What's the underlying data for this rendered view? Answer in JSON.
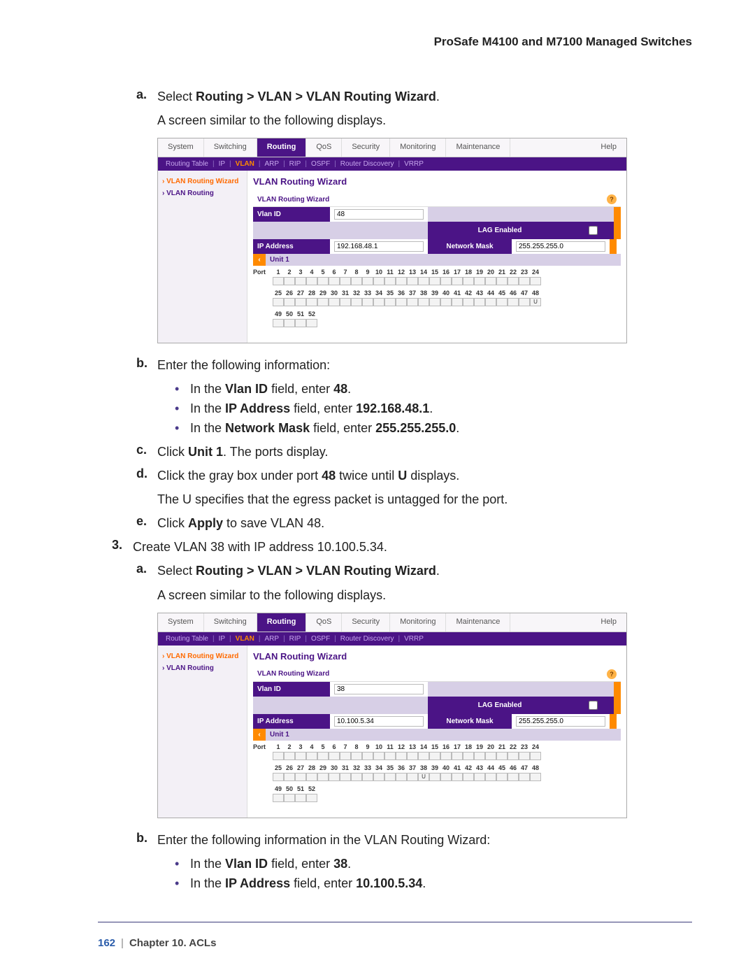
{
  "header": "ProSafe M4100 and M7100 Managed Switches",
  "stepA": {
    "marker": "a.",
    "text_pre": "Select ",
    "bold": "Routing > VLAN > VLAN Routing Wizard",
    "text_post": ".",
    "sub": "A screen similar to the following displays."
  },
  "shot1": {
    "tabs": [
      "System",
      "Switching",
      "Routing",
      "QoS",
      "Security",
      "Monitoring",
      "Maintenance",
      "Help"
    ],
    "tab_active": 2,
    "subtabs": [
      "Routing Table",
      "IP",
      "VLAN",
      "ARP",
      "RIP",
      "OSPF",
      "Router Discovery",
      "VRRP"
    ],
    "subtab_active": 2,
    "sidebar": [
      {
        "text": "VLAN Routing Wizard",
        "active": true
      },
      {
        "text": "VLAN Routing",
        "active": false
      }
    ],
    "title": "VLAN Routing Wizard",
    "section": "VLAN Routing Wizard",
    "fields": {
      "vlan_id_label": "Vlan ID",
      "vlan_id": "48",
      "lag_label": "LAG Enabled",
      "ip_label": "IP Address",
      "ip": "192.168.48.1",
      "mask_label": "Network Mask",
      "mask": "255.255.255.0"
    },
    "unit": {
      "toggle": "‹",
      "label": "Unit 1"
    },
    "port_row1": [
      "1",
      "2",
      "3",
      "4",
      "5",
      "6",
      "7",
      "8",
      "9",
      "10",
      "11",
      "12",
      "13",
      "14",
      "15",
      "16",
      "17",
      "18",
      "19",
      "20",
      "21",
      "22",
      "23",
      "24"
    ],
    "port_row2": [
      "25",
      "26",
      "27",
      "28",
      "29",
      "30",
      "31",
      "32",
      "33",
      "34",
      "35",
      "36",
      "37",
      "38",
      "39",
      "40",
      "41",
      "42",
      "43",
      "44",
      "45",
      "46",
      "47",
      "48"
    ],
    "port_row3": [
      "49",
      "50",
      "51",
      "52"
    ],
    "u_port": 48
  },
  "stepB": {
    "marker": "b.",
    "text": "Enter the following information:",
    "bullets": [
      {
        "pre": "In the ",
        "bold": "Vlan ID",
        "mid": " field, enter ",
        "bold2": "48",
        "post": "."
      },
      {
        "pre": "In the ",
        "bold": "IP Address",
        "mid": " field, enter ",
        "bold2": "192.168.48.1",
        "post": "."
      },
      {
        "pre": "In the ",
        "bold": "Network Mask",
        "mid": " field, enter ",
        "bold2": "255.255.255.0",
        "post": "."
      }
    ]
  },
  "stepC": {
    "marker": "c.",
    "pre": "Click ",
    "bold": "Unit 1",
    "post": ". The ports display."
  },
  "stepD": {
    "marker": "d.",
    "pre": "Click the gray box under port ",
    "bold": "48",
    "mid": " twice until ",
    "bold2": "U",
    "post": " displays.",
    "sub": "The U specifies that the egress packet is untagged for the port."
  },
  "stepE": {
    "marker": "e.",
    "pre": "Click ",
    "bold": "Apply",
    "post": " to save VLAN 48."
  },
  "step3": {
    "marker": "3.",
    "text": "Create VLAN 38 with IP address 10.100.5.34."
  },
  "step3a": {
    "marker": "a.",
    "text_pre": "Select ",
    "bold": "Routing > VLAN > VLAN Routing Wizard",
    "text_post": ".",
    "sub": "A screen similar to the following displays."
  },
  "shot2": {
    "tabs": [
      "System",
      "Switching",
      "Routing",
      "QoS",
      "Security",
      "Monitoring",
      "Maintenance",
      "Help"
    ],
    "tab_active": 2,
    "subtabs": [
      "Routing Table",
      "IP",
      "VLAN",
      "ARP",
      "RIP",
      "OSPF",
      "Router Discovery",
      "VRRP"
    ],
    "subtab_active": 2,
    "sidebar": [
      {
        "text": "VLAN Routing Wizard",
        "active": true
      },
      {
        "text": "VLAN Routing",
        "active": false
      }
    ],
    "title": "VLAN Routing Wizard",
    "section": "VLAN Routing Wizard",
    "fields": {
      "vlan_id_label": "Vlan ID",
      "vlan_id": "38",
      "lag_label": "LAG Enabled",
      "ip_label": "IP Address",
      "ip": "10.100.5.34",
      "mask_label": "Network Mask",
      "mask": "255.255.255.0"
    },
    "unit": {
      "toggle": "‹",
      "label": "Unit 1"
    },
    "port_row1": [
      "1",
      "2",
      "3",
      "4",
      "5",
      "6",
      "7",
      "8",
      "9",
      "10",
      "11",
      "12",
      "13",
      "14",
      "15",
      "16",
      "17",
      "18",
      "19",
      "20",
      "21",
      "22",
      "23",
      "24"
    ],
    "port_row2": [
      "25",
      "26",
      "27",
      "28",
      "29",
      "30",
      "31",
      "32",
      "33",
      "34",
      "35",
      "36",
      "37",
      "38",
      "39",
      "40",
      "41",
      "42",
      "43",
      "44",
      "45",
      "46",
      "47",
      "48"
    ],
    "port_row3": [
      "49",
      "50",
      "51",
      "52"
    ],
    "u_port": 38
  },
  "step3b": {
    "marker": "b.",
    "text": "Enter the following information in the VLAN Routing Wizard:",
    "bullets": [
      {
        "pre": "In the ",
        "bold": "Vlan ID",
        "mid": " field, enter ",
        "bold2": "38",
        "post": "."
      },
      {
        "pre": "In the ",
        "bold": "IP Address",
        "mid": " field, enter ",
        "bold2": "10.100.5.34",
        "post": "."
      }
    ]
  },
  "footer": {
    "page": "162",
    "chapter": "Chapter 10.  ACLs"
  }
}
